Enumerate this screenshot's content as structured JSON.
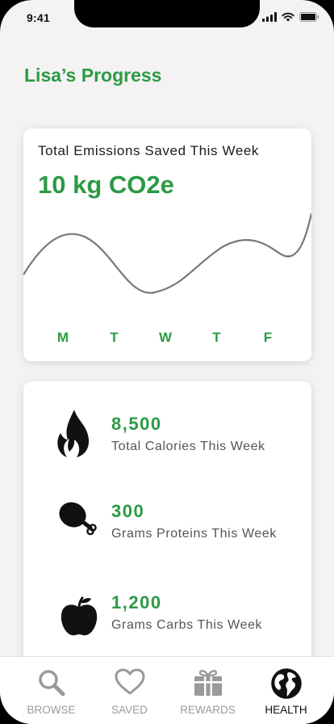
{
  "status_bar": {
    "time": "9:41"
  },
  "page": {
    "title": "Lisa’s Progress"
  },
  "emissions": {
    "title": "Total Emissions Saved This Week",
    "value": "10 kg CO2e"
  },
  "chart_data": {
    "type": "line",
    "categories": [
      "M",
      "T",
      "W",
      "T",
      "F"
    ],
    "title": "",
    "xlabel": "",
    "ylabel": "",
    "grid": false
  },
  "stats": [
    {
      "value": "8,500",
      "label": "Total Calories This Week",
      "icon": "flame-icon"
    },
    {
      "value": "300",
      "label": "Grams Proteins This Week",
      "icon": "drumstick-icon"
    },
    {
      "value": "1,200",
      "label": "Grams Carbs This Week",
      "icon": "apple-icon"
    }
  ],
  "tabs": [
    {
      "label": "BROWSE",
      "icon": "search-icon",
      "active": false
    },
    {
      "label": "SAVED",
      "icon": "heart-icon",
      "active": false
    },
    {
      "label": "REWARDS",
      "icon": "gift-icon",
      "active": false
    },
    {
      "label": "HEALTH",
      "icon": "globe-icon",
      "active": true
    }
  ],
  "colors": {
    "accent": "#2b9a45",
    "background": "#f4f2f2",
    "line": "#777777"
  }
}
